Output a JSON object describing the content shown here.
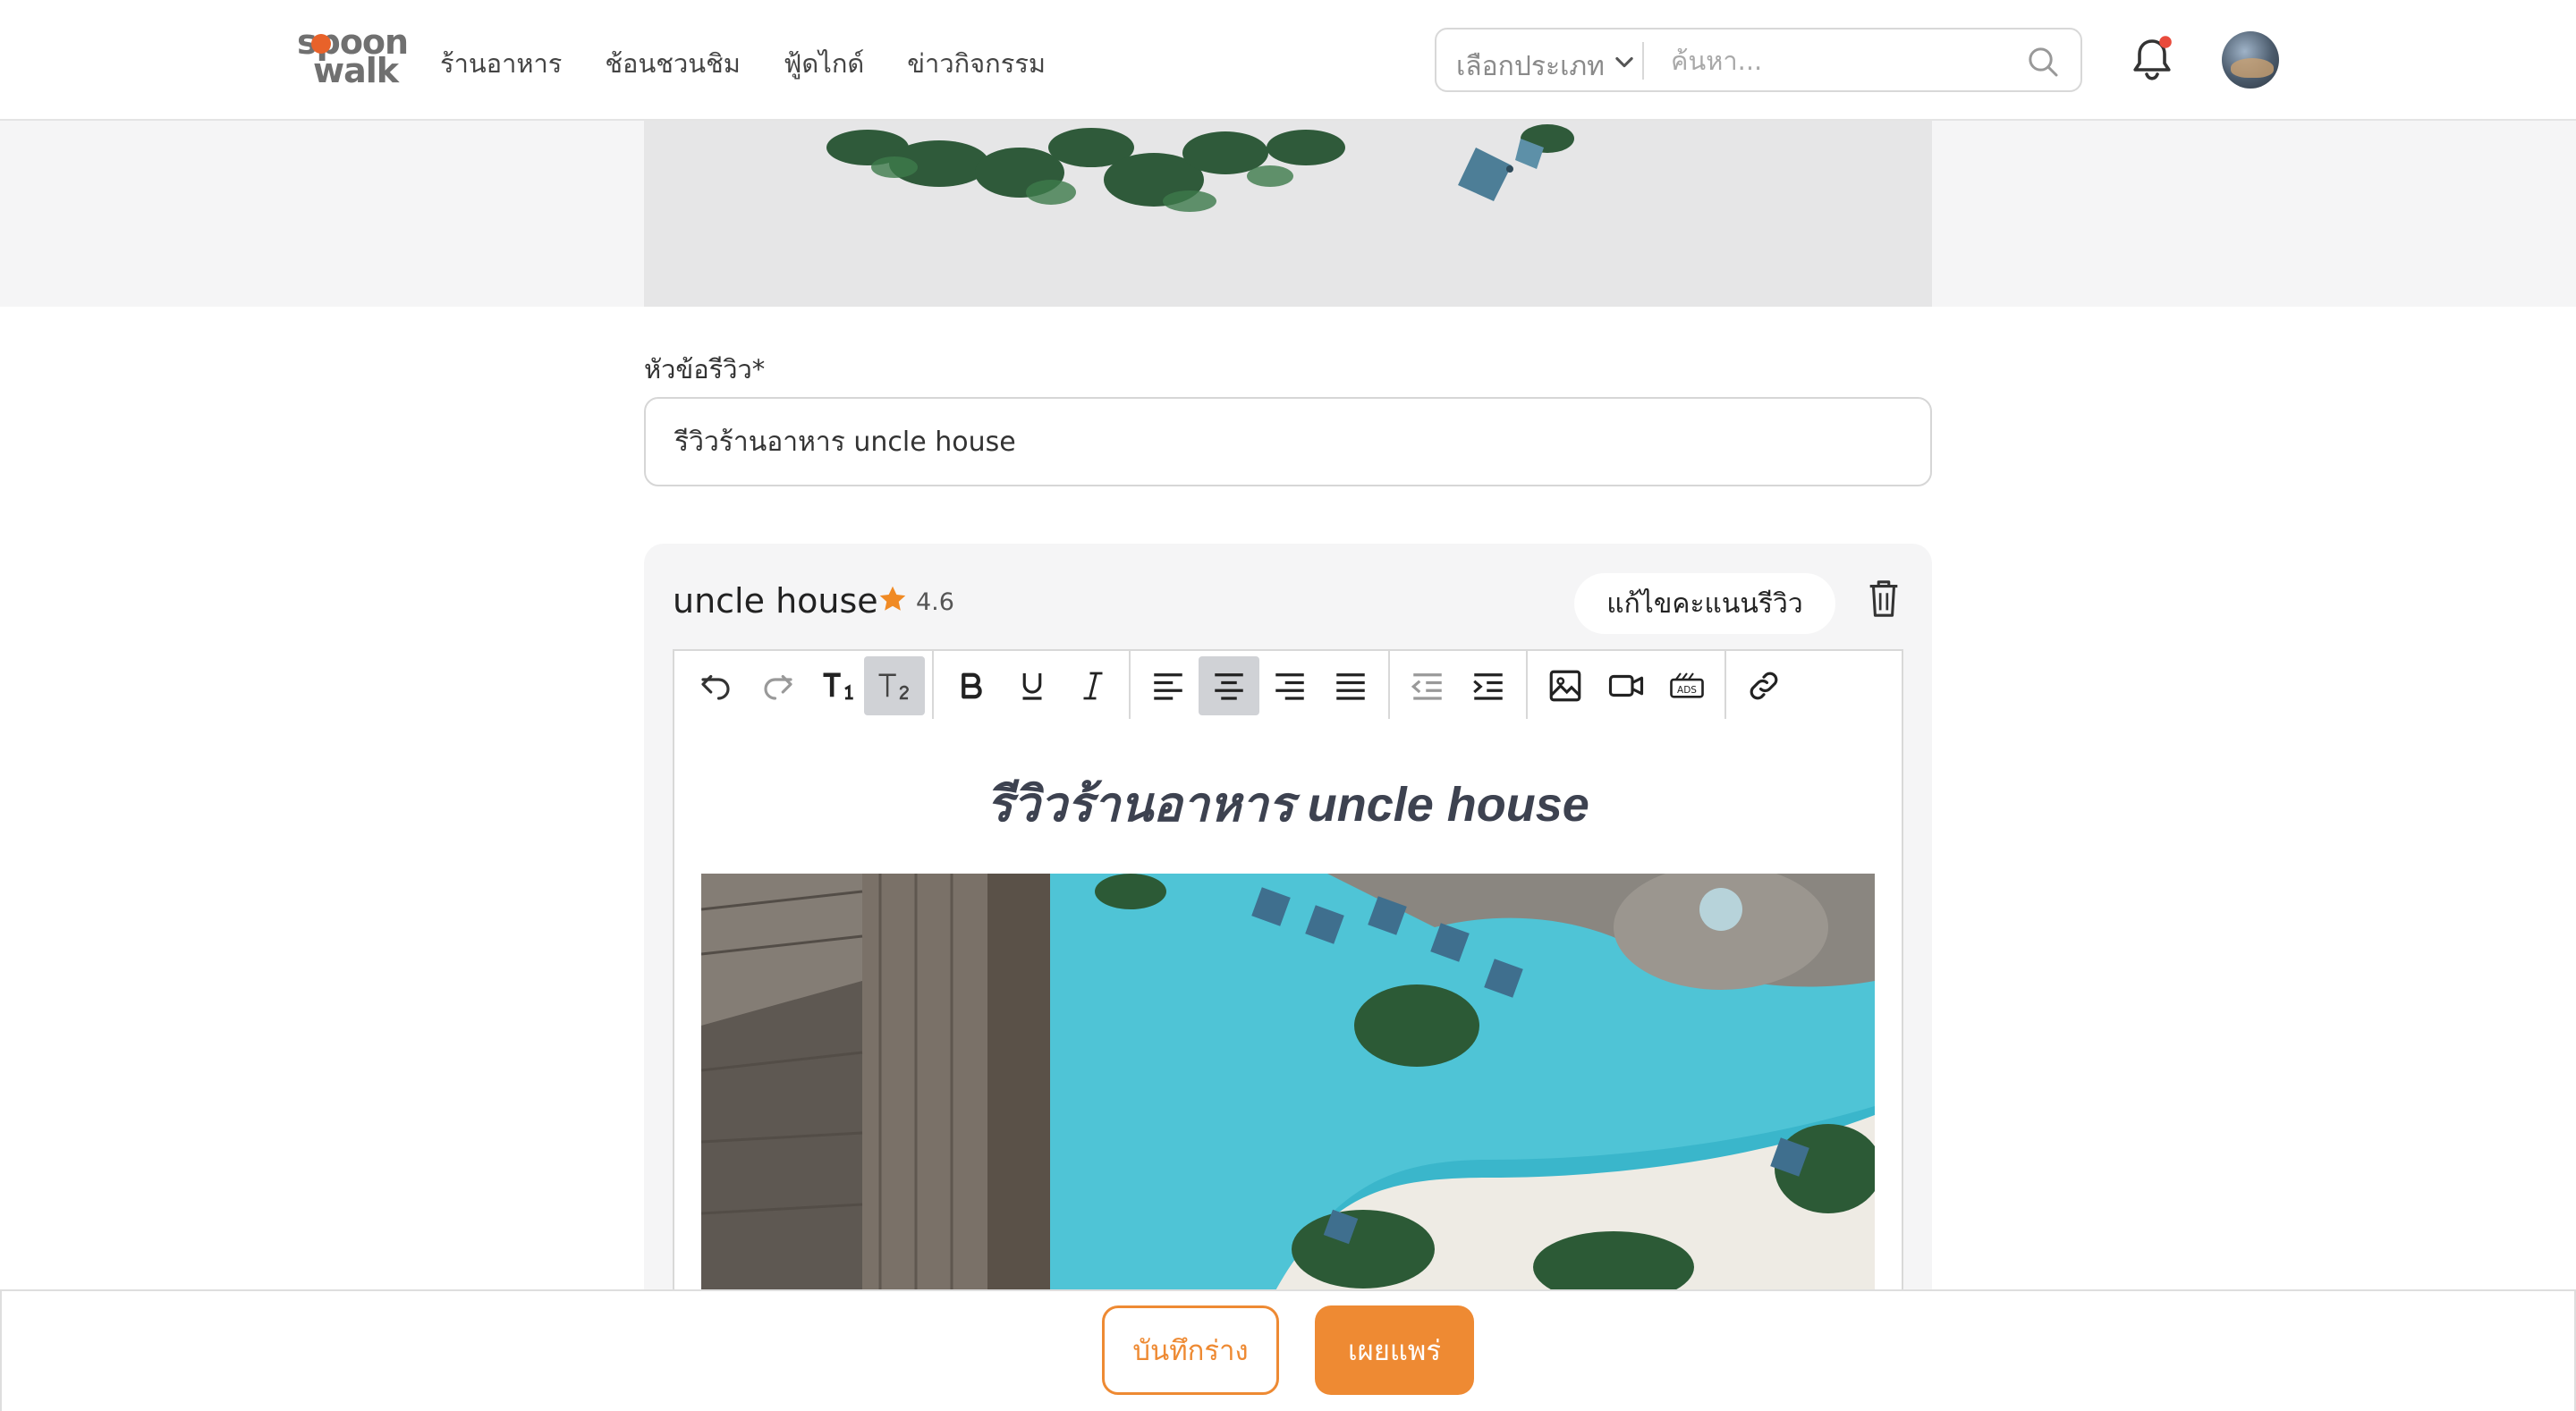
{
  "brand": {
    "logo_line1": "spoon",
    "logo_line2": "walk",
    "accent": "#ee8a33"
  },
  "nav": {
    "items": [
      {
        "label": "ร้านอาหาร"
      },
      {
        "label": "ช้อนชวนชิม"
      },
      {
        "label": "ฟู้ดไกด์"
      },
      {
        "label": "ข่าวกิจกรรม"
      }
    ],
    "category_select": "เลือกประเภท",
    "search_placeholder": "ค้นหา...",
    "notification_dot_color": "#e94b3c"
  },
  "form": {
    "title_label": "หัวข้อรีวิว*",
    "title_value": "รีวิวร้านอาหาร uncle house"
  },
  "restaurant": {
    "name": "uncle house",
    "rating": "4.6",
    "edit_rating_label": "แก้ไขคะแนนรีวิว"
  },
  "editor": {
    "toolbar": [
      "undo-icon",
      "redo-icon",
      "heading1-icon",
      "heading2-icon",
      "bold-icon",
      "underline-icon",
      "italic-icon",
      "align-left-icon",
      "align-center-icon",
      "align-right-icon",
      "align-justify-icon",
      "outdent-icon",
      "indent-icon",
      "image-icon",
      "video-icon",
      "ads-icon",
      "link-icon"
    ],
    "active": [
      "heading2-icon",
      "align-center-icon"
    ],
    "heading": "รีวิวร้านอาหาร uncle house"
  },
  "actions": {
    "save_draft": "บันทึกร่าง",
    "publish": "เผยแพร่"
  }
}
